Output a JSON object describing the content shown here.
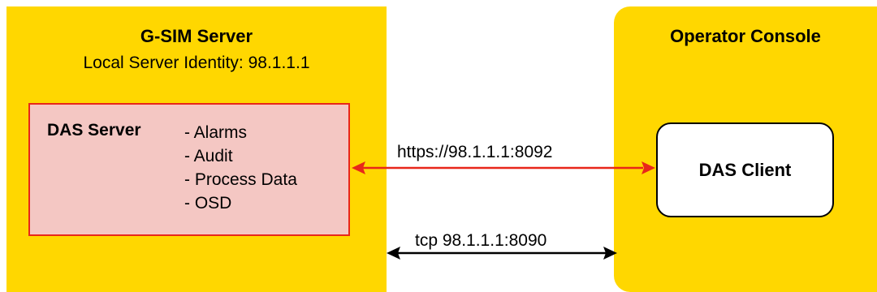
{
  "server": {
    "title": "G-SIM Server",
    "subtitle": "Local Server Identity: 98.1.1.1",
    "das_server": {
      "label": "DAS Server",
      "items": [
        "- Alarms",
        "- Audit",
        "- Process Data",
        "- OSD"
      ]
    }
  },
  "console": {
    "title": "Operator Console",
    "das_client": {
      "label": "DAS Client"
    }
  },
  "connections": {
    "https": {
      "label": "https://98.1.1.1:8092",
      "color": "#E8271A"
    },
    "tcp": {
      "label": "tcp 98.1.1.1:8090",
      "color": "#000000"
    }
  },
  "colors": {
    "container_fill": "#FFD700",
    "das_server_fill": "#F4C7C3",
    "das_server_border": "#E8271A",
    "das_client_fill": "#FFFFFF"
  }
}
